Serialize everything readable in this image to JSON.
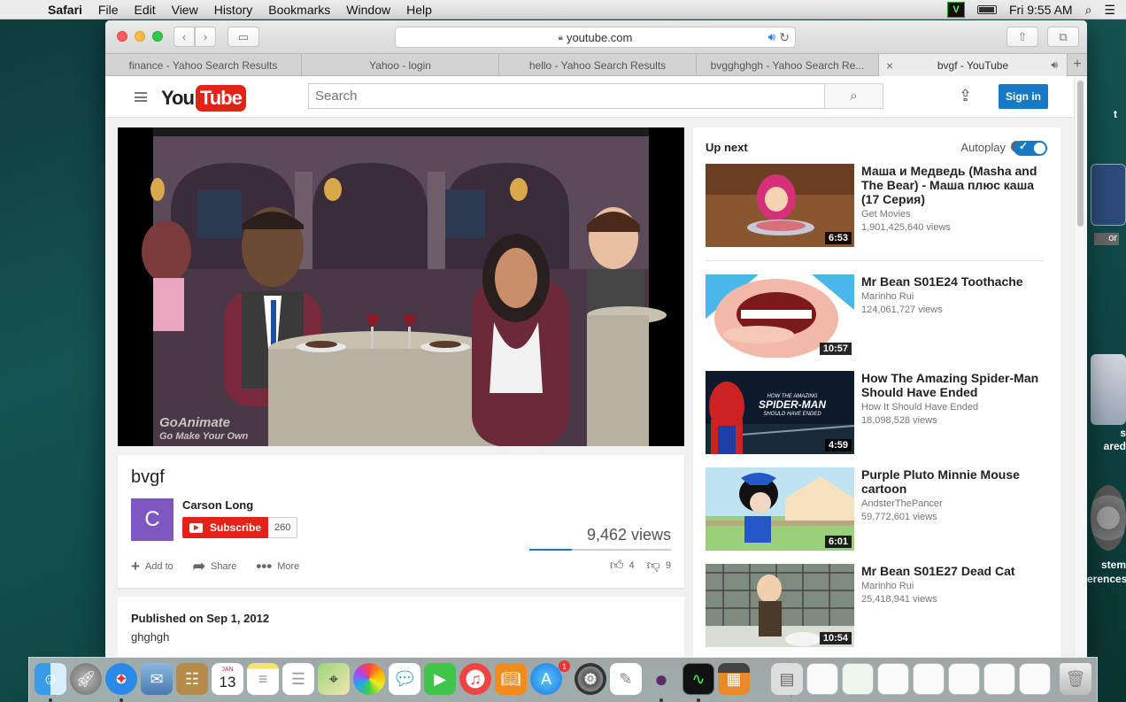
{
  "menubar": {
    "app": "Safari",
    "items": [
      "File",
      "Edit",
      "View",
      "History",
      "Bookmarks",
      "Window",
      "Help"
    ],
    "clock": "Fri 9:55 AM",
    "vc_badge": "V"
  },
  "browser": {
    "url": "youtube.com",
    "tabs": [
      {
        "label": "finance - Yahoo Search Results"
      },
      {
        "label": "Yahoo - login"
      },
      {
        "label": "hello - Yahoo Search Results"
      },
      {
        "label": "bvgghghgh - Yahoo Search Re..."
      },
      {
        "label": "bvgf - YouTube"
      }
    ]
  },
  "youtube": {
    "search_placeholder": "Search",
    "signin_label": "Sign in",
    "logo_you": "You",
    "logo_tube": "Tube",
    "video": {
      "title": "bvgf",
      "watermark_1": "GoAnimate",
      "watermark_2": "Go Make Your Own",
      "channel": "Carson Long",
      "avatar_letter": "C",
      "subscribe_label": "Subscribe",
      "subscriber_count": "260",
      "views": "9,462 views",
      "like_ratio": 0.3,
      "actions": [
        {
          "label": "Add to",
          "icon": "plus-icon"
        },
        {
          "label": "Share",
          "icon": "share-icon"
        },
        {
          "label": "More",
          "icon": "more-icon"
        }
      ],
      "likes": "4",
      "dislikes": "9",
      "published": "Published on Sep 1, 2012",
      "description": "ghghgh"
    },
    "sidebar": {
      "up_next": "Up next",
      "autoplay": "Autoplay",
      "items": [
        {
          "title": "Маша и Медведь (Masha and The Bear) - Маша плюс каша (17 Серия)",
          "channel": "Get Movies",
          "views": "1,901,425,640 views",
          "duration": "6:53"
        },
        {
          "title": "Mr Bean S01E24 Toothache",
          "channel": "Marinho Rui",
          "views": "124,061,727 views",
          "duration": "10:57"
        },
        {
          "title": "How The Amazing Spider-Man Should Have Ended",
          "channel": "How It Should Have Ended",
          "views": "18,098,528 views",
          "duration": "4:59"
        },
        {
          "title": "Purple Pluto Minnie Mouse cartoon",
          "channel": "AndsterThePancer",
          "views": "59,772,601 views",
          "duration": "6:01"
        },
        {
          "title": "Mr Bean S01E27 Dead Cat",
          "channel": "Marinho Rui",
          "views": "25,418,941 views",
          "duration": "10:54"
        }
      ],
      "thumb2_text_1": "HOW THE AMAZING",
      "thumb2_text_2": "SPIDER-MAN",
      "thumb2_text_3": "SHOULD HAVE ENDED"
    }
  },
  "desktop": {
    "label_1": "s",
    "label_2": "ared",
    "label_3": "stem",
    "label_4": "erences",
    "label_5": "t",
    "label_6": "or"
  },
  "dock": {
    "calendar_month": "JAN",
    "calendar_day": "13",
    "appstore_badge": "1"
  }
}
